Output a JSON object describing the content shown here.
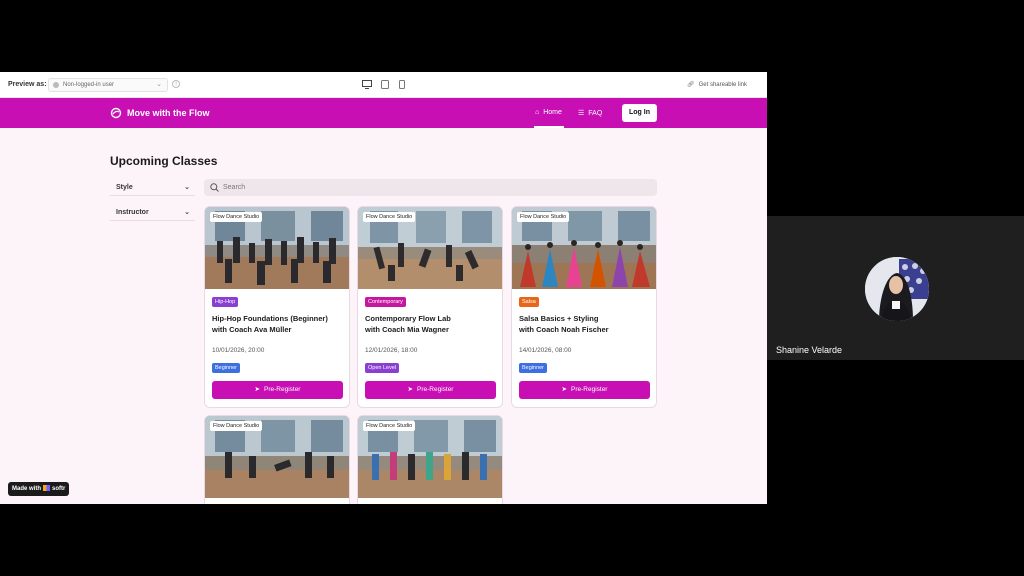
{
  "preview_bar": {
    "label": "Preview as:",
    "user": "Non-logged-in user",
    "share": "Get shareable link"
  },
  "header": {
    "brand": "Move with the Flow",
    "nav": [
      {
        "label": "Home"
      },
      {
        "label": "FAQ"
      }
    ],
    "login": "Log In"
  },
  "page": {
    "title": "Upcoming Classes",
    "filters": [
      "Style",
      "Instructor"
    ],
    "search_placeholder": "Search"
  },
  "cards": [
    {
      "studio": "Flow Dance Studio",
      "style": "Hip-Hop",
      "style_color": "#8a3fd1",
      "title_line1": "Hip-Hop Foundations (Beginner)",
      "title_line2": "with Coach Ava Müller",
      "date": "10/01/2026, 20:00",
      "level": "Beginner",
      "level_color": "#3d6fe0",
      "button": "Pre-Register"
    },
    {
      "studio": "Flow Dance Studio",
      "style": "Contemporary",
      "style_color": "#c6169f",
      "title_line1": "Contemporary Flow Lab",
      "title_line2": "with Coach Mia Wagner",
      "date": "12/01/2026, 18:00",
      "level": "Open Level",
      "level_color": "#8a3fd1",
      "button": "Pre-Register"
    },
    {
      "studio": "Flow Dance Studio",
      "style": "Salsa",
      "style_color": "#e8661a",
      "title_line1": "Salsa Basics + Styling",
      "title_line2": "with Coach Noah Fischer",
      "date": "14/01/2026, 08:00",
      "level": "Beginner",
      "level_color": "#3d6fe0",
      "button": "Pre-Register"
    },
    {
      "studio": "Flow Dance Studio"
    },
    {
      "studio": "Flow Dance Studio"
    }
  ],
  "made_with": {
    "prefix": "Made with",
    "brand": "softr"
  },
  "participant": {
    "name": "Shanine Velarde"
  },
  "colors": {
    "accent": "#c80fb4",
    "page_bg": "#fdf4fa"
  }
}
